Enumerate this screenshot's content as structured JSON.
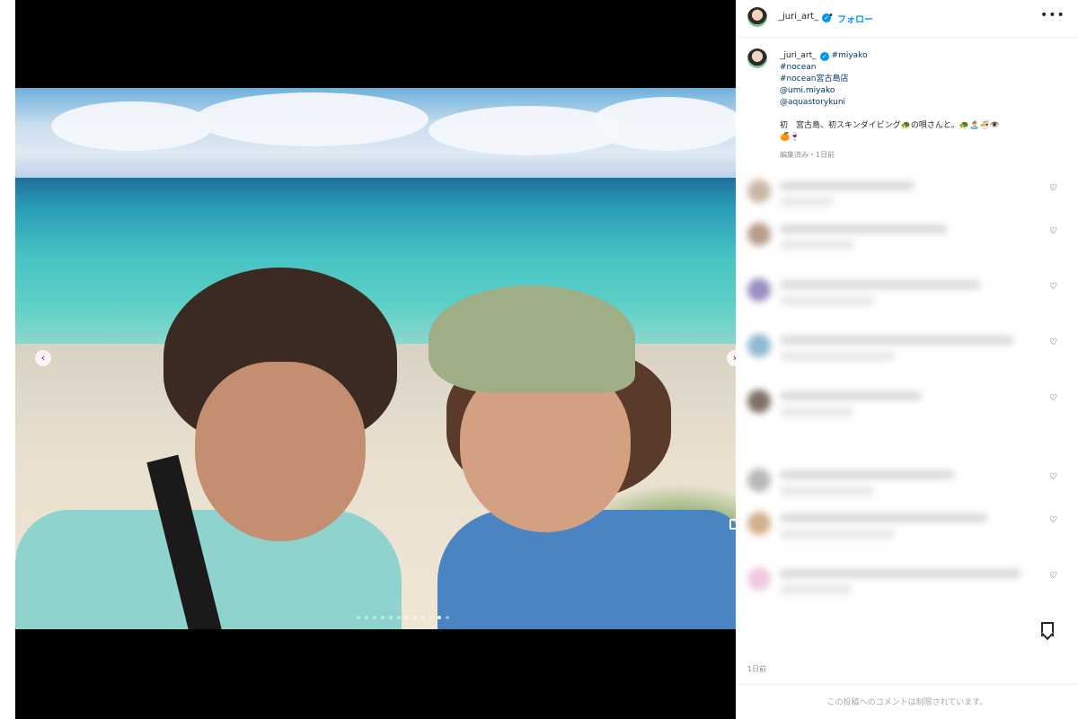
{
  "post": {
    "username": "_juri_art_",
    "follow_label": "フォロー",
    "separator": "•",
    "more_label": "•••"
  },
  "caption": {
    "username": "_juri_art_",
    "lines": [
      "#miyako",
      "#nocean",
      "#nocean宮古島店",
      "@umi.miyako",
      "@aquastorykuni"
    ],
    "body": "初　宮古島、初スキンダイビング🐢の唄さんと。🐢🏝️🍜👁️",
    "body2": "🍊🍷",
    "meta": "編集済み・1日前"
  },
  "carousel": {
    "prev": "‹",
    "next": "›",
    "total": 12,
    "active_index": 10
  },
  "post_time": "1日前",
  "comments_disabled": "この投稿へのコメントは制限されています。",
  "comments": {
    "heart_icon": "♡",
    "count": 8
  },
  "colors": {
    "accent": "#0095f6",
    "tag": "#00376b",
    "muted": "#8e8e8e"
  }
}
